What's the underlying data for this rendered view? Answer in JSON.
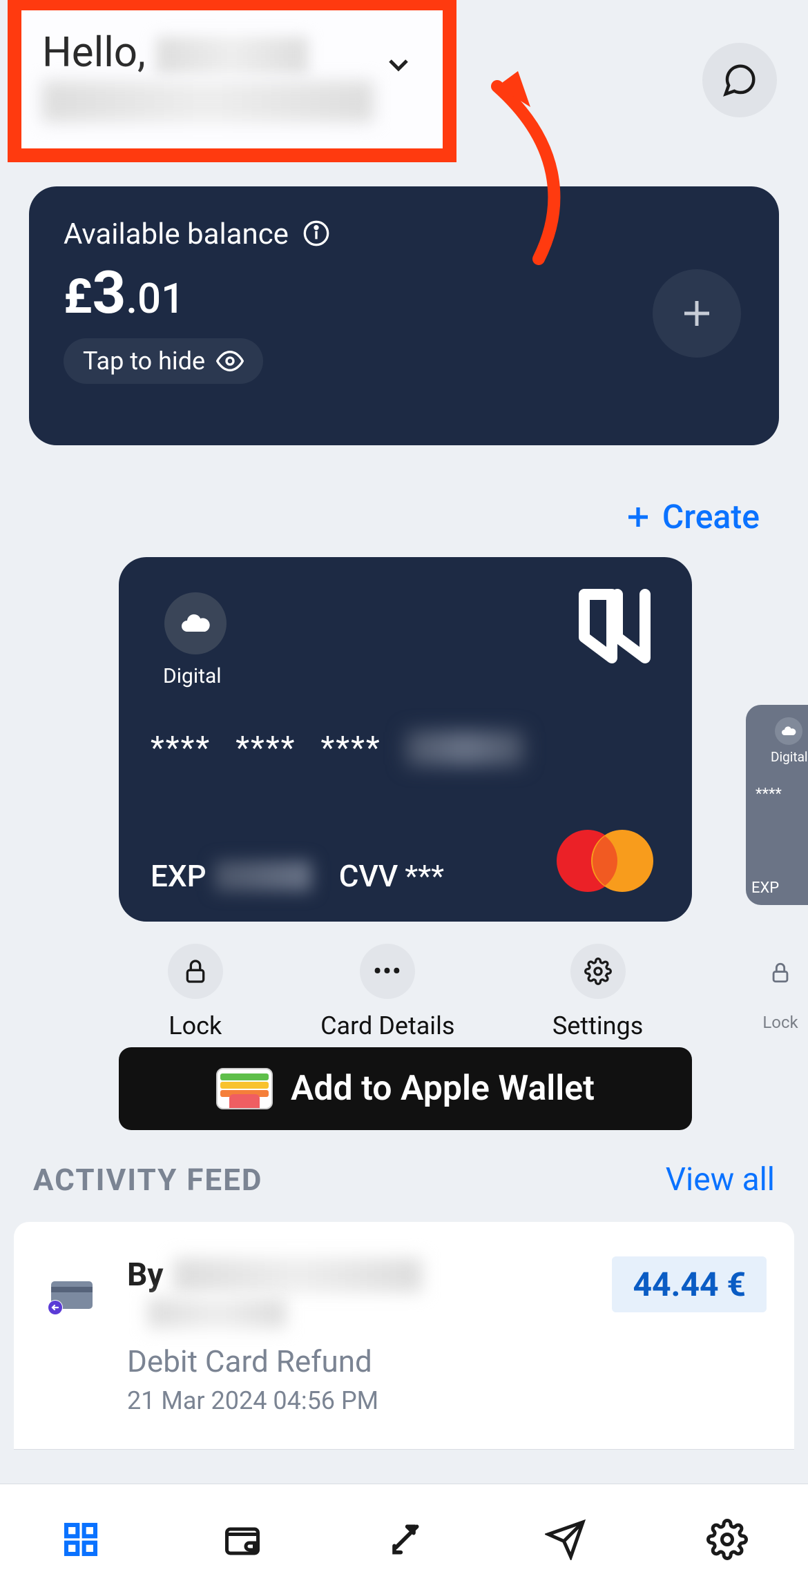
{
  "header": {
    "greeting_prefix": "Hello,",
    "chat_aria": "Chat"
  },
  "balance": {
    "label": "Available balance",
    "currency": "£",
    "integer": "3",
    "fraction": ".01",
    "hide_label": "Tap to hide"
  },
  "create": {
    "label": "Create",
    "plus": "+"
  },
  "card": {
    "type_label": "Digital",
    "masked_group": "****",
    "exp_label": "EXP",
    "cvv_label": "CVV",
    "cvv_value": "***"
  },
  "card2": {
    "type_label": "Digital",
    "masked_group": "****",
    "exp_label": "EXP"
  },
  "card_actions": {
    "lock": "Lock",
    "details": "Card Details",
    "settings": "Settings",
    "peek_lock": "Lock"
  },
  "wallet": {
    "label": "Add to Apple Wallet"
  },
  "activity": {
    "title": "ACTIVITY FEED",
    "view_all": "View all",
    "items": [
      {
        "by_prefix": "By",
        "type": "Debit Card Refund",
        "timestamp": "21 Mar 2024 04:56 PM",
        "amount": "44.44 €"
      }
    ]
  },
  "bottombar": {
    "items": [
      "home",
      "wallet",
      "transfer",
      "send",
      "settings"
    ]
  },
  "colors": {
    "accent": "#0a72ff",
    "card_bg": "#1d2a44",
    "annotation": "#ff3a0f"
  }
}
